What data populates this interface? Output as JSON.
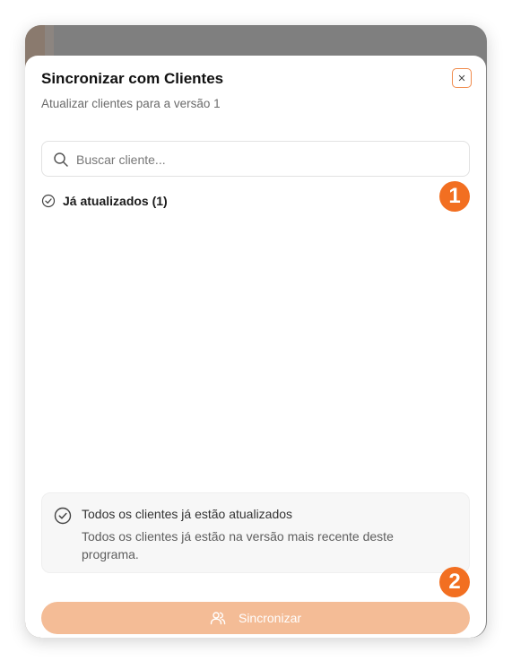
{
  "modal": {
    "title": "Sincronizar com Clientes",
    "subtitle": "Atualizar clientes para a versão 1",
    "close_icon": "close-icon"
  },
  "search": {
    "placeholder": "Buscar cliente...",
    "value": "",
    "icon": "search-icon"
  },
  "section": {
    "label": "Já atualizados (1)",
    "icon": "check-circle-icon"
  },
  "annotations": [
    "1",
    "2"
  ],
  "info": {
    "title": "Todos os clientes já estão atualizados",
    "description": "Todos os clientes já estão na versão mais recente deste programa.",
    "icon": "check-circle-icon"
  },
  "footer": {
    "sync_label": "Sincronizar",
    "icon": "users-icon"
  },
  "colors": {
    "accent": "#f26f21",
    "button_disabled": "#f4bc96",
    "close_border": "#f08a4b"
  }
}
